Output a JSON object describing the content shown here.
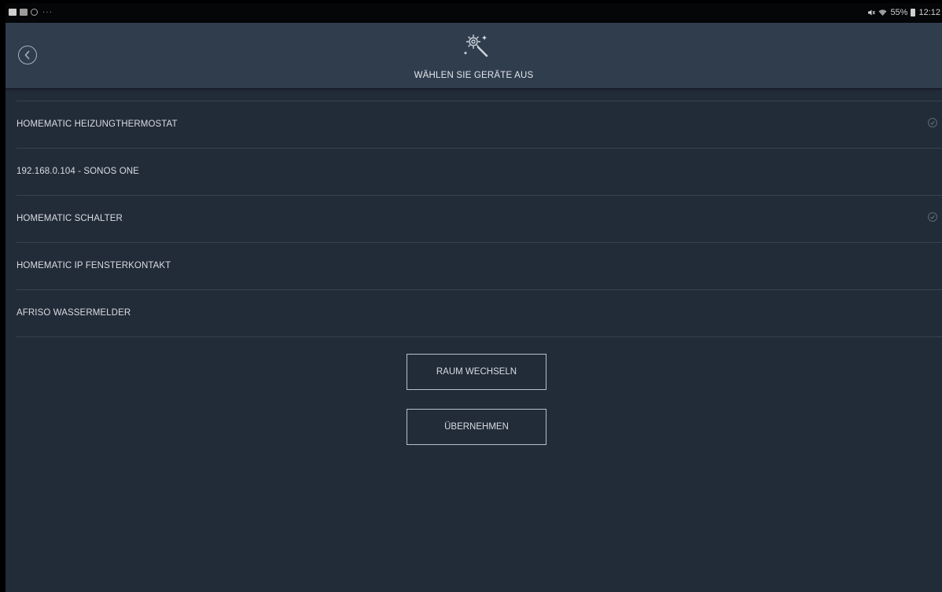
{
  "status_bar": {
    "left_dots": "···",
    "battery_percent": "55%",
    "time": "12:12"
  },
  "header": {
    "title": "WÄHLEN SIE GERÄTE AUS",
    "icon": "gear-wand-icon",
    "back_icon": "back-chevron-circle-icon"
  },
  "devices": [
    {
      "label": "HOMEMATIC HEIZUNGTHERMOSTAT",
      "selected": true
    },
    {
      "label": "192.168.0.104 - SONOS ONE",
      "selected": false
    },
    {
      "label": "HOMEMATIC SCHALTER",
      "selected": true
    },
    {
      "label": "HOMEMATIC IP FENSTERKONTAKT",
      "selected": false
    },
    {
      "label": "AFRISO WASSERMELDER",
      "selected": false
    }
  ],
  "buttons": {
    "change_room": "RAUM WECHSELN",
    "apply": "ÜBERNEHMEN"
  },
  "colors": {
    "background": "#222b38",
    "header": "#303d4d",
    "divider": "#38414e",
    "text": "#d9dde2"
  }
}
